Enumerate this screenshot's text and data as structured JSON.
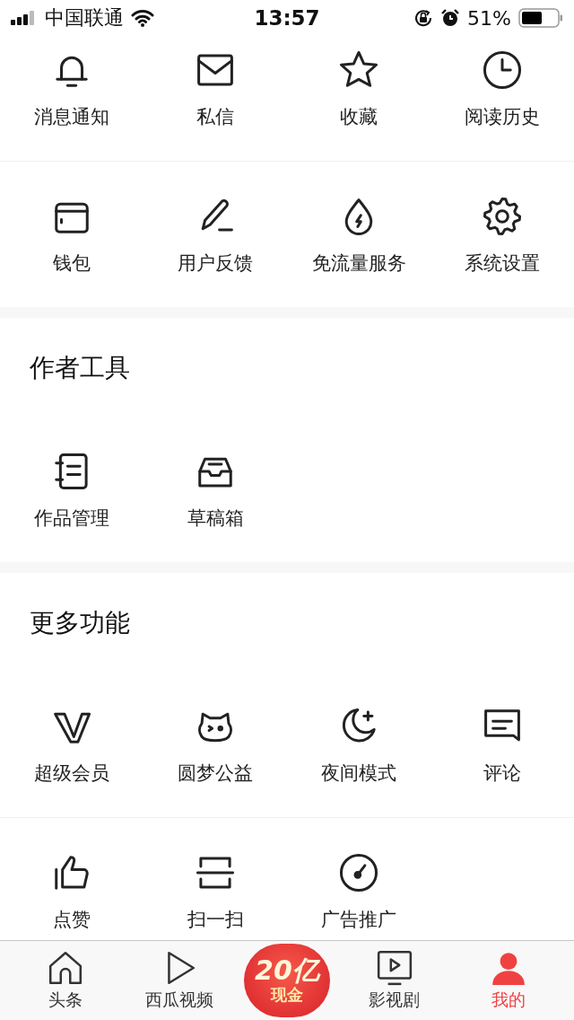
{
  "status_bar": {
    "carrier": "中国联通",
    "time": "13:57",
    "battery": "51%"
  },
  "sections": [
    {
      "rows": [
        [
          {
            "label": "消息通知"
          },
          {
            "label": "私信"
          },
          {
            "label": "收藏"
          },
          {
            "label": "阅读历史"
          }
        ],
        [
          {
            "label": "钱包"
          },
          {
            "label": "用户反馈"
          },
          {
            "label": "免流量服务"
          },
          {
            "label": "系统设置"
          }
        ]
      ]
    },
    {
      "title": "作者工具",
      "rows": [
        [
          {
            "label": "作品管理"
          },
          {
            "label": "草稿箱"
          }
        ]
      ]
    },
    {
      "title": "更多功能",
      "rows": [
        [
          {
            "label": "超级会员"
          },
          {
            "label": "圆梦公益"
          },
          {
            "label": "夜间模式"
          },
          {
            "label": "评论"
          }
        ],
        [
          {
            "label": "点赞"
          },
          {
            "label": "扫一扫"
          },
          {
            "label": "广告推广"
          }
        ]
      ]
    }
  ],
  "tab_bar": {
    "items": [
      {
        "kind": "tab",
        "label": "头条",
        "selected": false
      },
      {
        "kind": "tab",
        "label": "西瓜视频",
        "selected": false
      },
      {
        "kind": "promo",
        "line_1": "20亿",
        "line_2": "现金"
      },
      {
        "kind": "tab",
        "label": "影视剧",
        "selected": false
      },
      {
        "kind": "tab",
        "label": "我的",
        "selected": true
      }
    ]
  }
}
